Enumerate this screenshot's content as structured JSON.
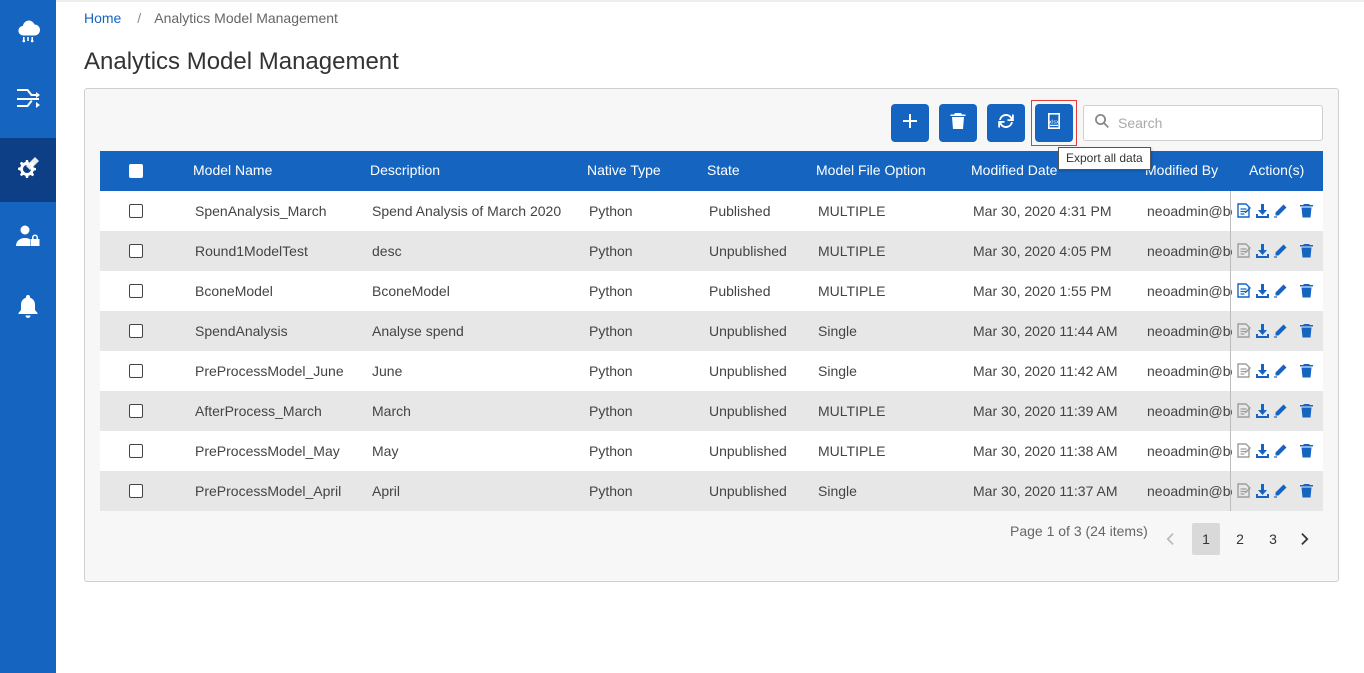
{
  "breadcrumb": {
    "home": "Home",
    "separator": "/",
    "current": "Analytics Model Management"
  },
  "page_title": "Analytics Model Management",
  "search": {
    "placeholder": "Search",
    "value": ""
  },
  "tooltip": "Export all data",
  "export_icon_text": "xlsx",
  "columns": [
    "Model Name",
    "Description",
    "Native Type",
    "State",
    "Model File Option",
    "Modified Date",
    "Modified By",
    "Action(s)"
  ],
  "rows": [
    {
      "name": "SpenAnalysis_March",
      "description": "Spend Analysis of March 2020",
      "type": "Python",
      "state": "Published",
      "option": "MULTIPLE",
      "date": "Mar 30, 2020 4:31 PM",
      "by": "neoadmin@bc"
    },
    {
      "name": "Round1ModelTest",
      "description": "desc",
      "type": "Python",
      "state": "Unpublished",
      "option": "MULTIPLE",
      "date": "Mar 30, 2020 4:05 PM",
      "by": "neoadmin@bc"
    },
    {
      "name": "BconeModel",
      "description": "BconeModel",
      "type": "Python",
      "state": "Published",
      "option": "MULTIPLE",
      "date": "Mar 30, 2020 1:55 PM",
      "by": "neoadmin@bc"
    },
    {
      "name": "SpendAnalysis",
      "description": "Analyse spend",
      "type": "Python",
      "state": "Unpublished",
      "option": "Single",
      "date": "Mar 30, 2020 11:44 AM",
      "by": "neoadmin@bc"
    },
    {
      "name": "PreProcessModel_June",
      "description": "June",
      "type": "Python",
      "state": "Unpublished",
      "option": "Single",
      "date": "Mar 30, 2020 11:42 AM",
      "by": "neoadmin@bc"
    },
    {
      "name": "AfterProcess_March",
      "description": "March",
      "type": "Python",
      "state": "Unpublished",
      "option": "MULTIPLE",
      "date": "Mar 30, 2020 11:39 AM",
      "by": "neoadmin@bc"
    },
    {
      "name": "PreProcessModel_May",
      "description": "May",
      "type": "Python",
      "state": "Unpublished",
      "option": "MULTIPLE",
      "date": "Mar 30, 2020 11:38 AM",
      "by": "neoadmin@bc"
    },
    {
      "name": "PreProcessModel_April",
      "description": "April",
      "type": "Python",
      "state": "Unpublished",
      "option": "Single",
      "date": "Mar 30, 2020 11:37 AM",
      "by": "neoadmin@bc"
    }
  ],
  "pagination": {
    "summary": "Page 1 of 3 (24 items)",
    "pages": [
      "1",
      "2",
      "3"
    ],
    "current": "1"
  },
  "colors": {
    "primary": "#1565c0",
    "sidebar_active": "#0d3f87",
    "highlight_outline": "#e53935",
    "row_alt": "#e7e7e7"
  },
  "icons": {
    "sidebar": [
      "cloud-network-icon",
      "data-flow-icon",
      "model-gear-icon",
      "user-lock-icon",
      "bell-icon"
    ],
    "toolbar": [
      "plus-icon",
      "trash-icon",
      "refresh-icon",
      "xlsx-export-icon"
    ],
    "actions": [
      "publish-document-icon",
      "download-icon",
      "edit-pencil-icon",
      "delete-trash-icon"
    ]
  }
}
